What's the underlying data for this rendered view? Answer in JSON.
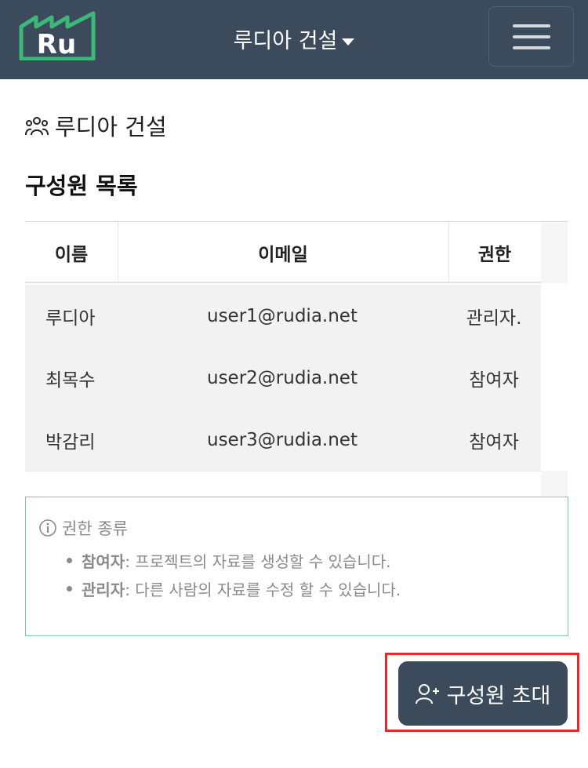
{
  "header": {
    "logo_text": "Ru",
    "brand": "루디아 건설",
    "menu_icon": "hamburger-icon",
    "logo_color": "#3cb878",
    "bg_color": "#3c4b5c"
  },
  "org": {
    "icon": "group-icon",
    "name": "루디아 건설"
  },
  "section_title": "구성원 목록",
  "table": {
    "headers": [
      "이름",
      "이메일",
      "권한"
    ],
    "rows": [
      {
        "name": "루디아",
        "email": "user1@rudia.net",
        "role": "관리자."
      },
      {
        "name": "최목수",
        "email": "user2@rudia.net",
        "role": "참여자"
      },
      {
        "name": "박감리",
        "email": "user3@rudia.net",
        "role": "참여자"
      }
    ]
  },
  "info": {
    "icon": "info-circle-icon",
    "title": "권한 종류",
    "items": [
      {
        "term": "참여자",
        "desc": " : 프로젝트의 자료를 생성할 수 있습니다."
      },
      {
        "term": "관리자",
        "desc": " : 다른 사람의 자료를 수정 할 수 있습니다."
      }
    ],
    "border_color": "#7fc4a4"
  },
  "invite_button": {
    "icon": "user-plus-icon",
    "label": "구성원 초대",
    "highlight_color": "#e32b2b"
  }
}
